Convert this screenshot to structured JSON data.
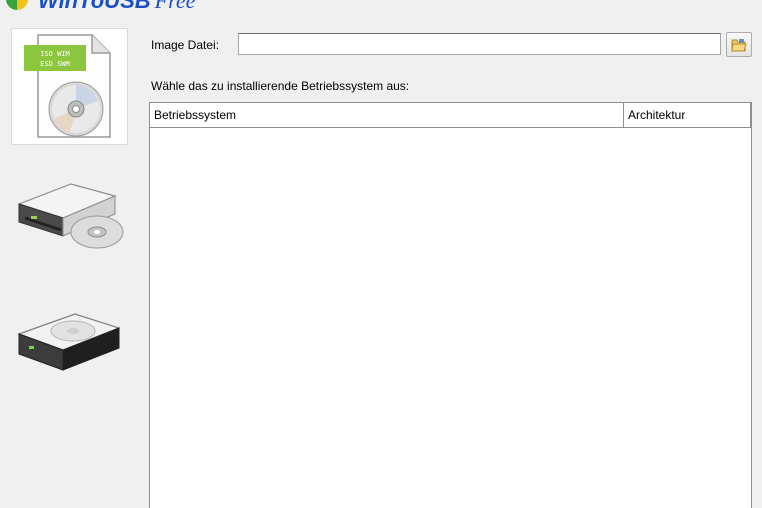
{
  "app": {
    "title": "WinToUSB",
    "edition": "Free"
  },
  "sidebar": {
    "items": [
      {
        "name": "image-file",
        "selected": true,
        "iso_badge_line1": "ISO WIM",
        "iso_badge_line2": "ESD SWM"
      },
      {
        "name": "cd-dvd-drive",
        "selected": false
      },
      {
        "name": "hard-disk",
        "selected": false
      }
    ]
  },
  "image_file": {
    "label": "Image Datei:",
    "value": "",
    "placeholder": ""
  },
  "select_prompt": "Wähle das zu installierende Betriebssystem aus:",
  "os_table": {
    "columns": [
      "Betriebssystem",
      "Architektur"
    ],
    "rows": []
  },
  "colors": {
    "accent": "#1a4fc7",
    "window_bg": "#f0f0f0",
    "badge_green": "#8cc63f"
  }
}
